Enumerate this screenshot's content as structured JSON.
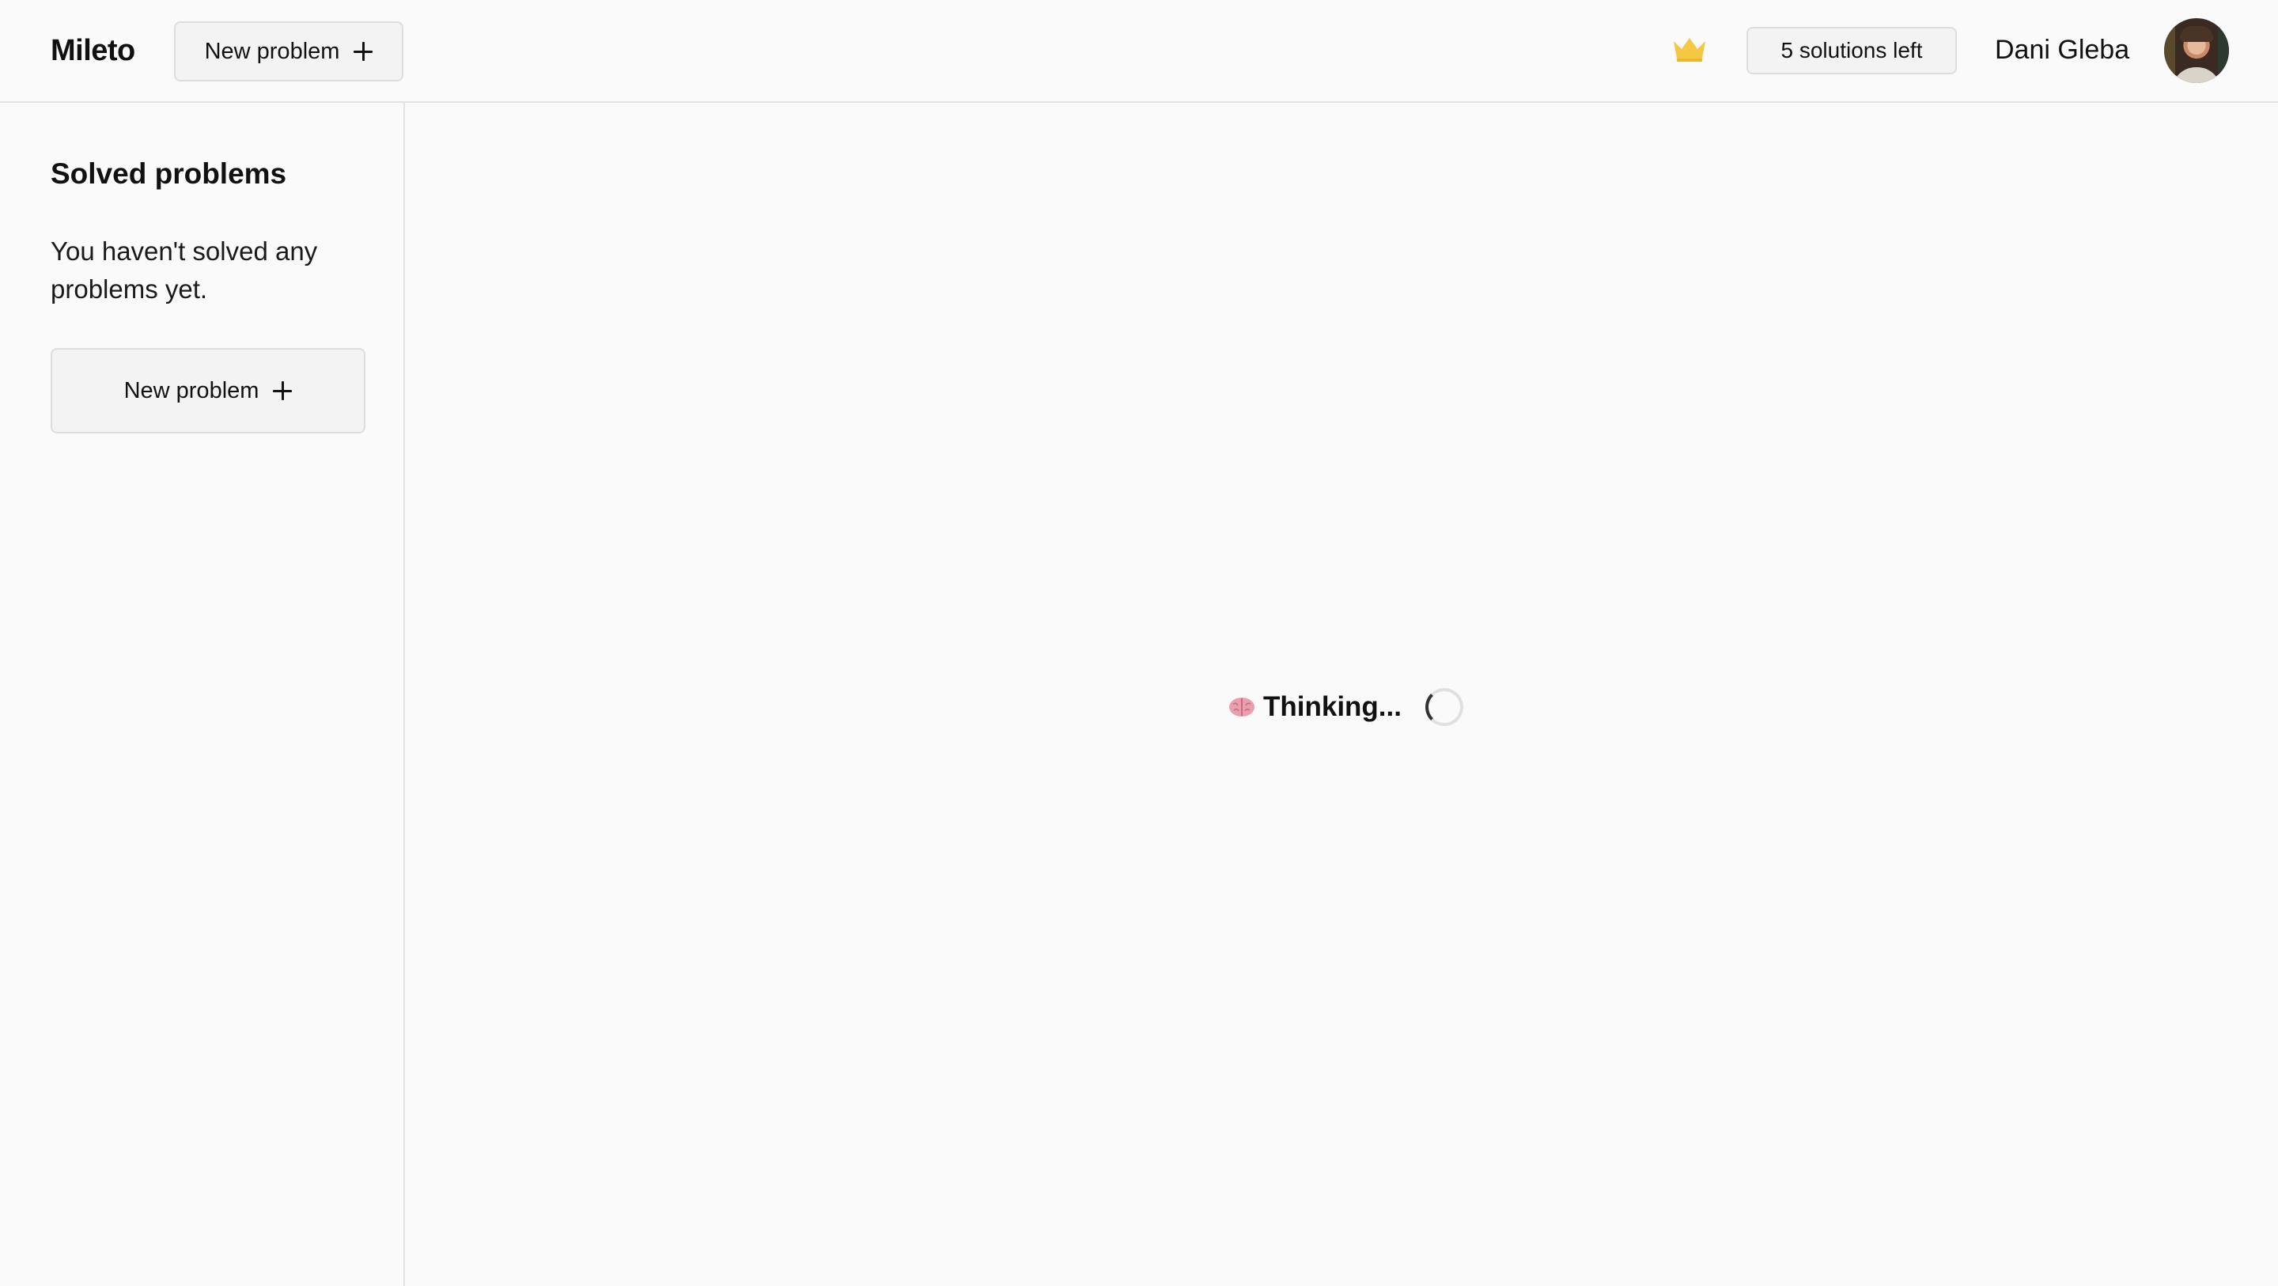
{
  "header": {
    "app_title": "Mileto",
    "new_problem_label": "New problem",
    "solutions_badge": "5 solutions left",
    "user_name": "Dani Gleba"
  },
  "sidebar": {
    "title": "Solved problems",
    "empty_message": "You haven't solved any problems yet.",
    "new_problem_label": "New problem"
  },
  "main": {
    "status_text": "Thinking..."
  },
  "icons": {
    "crown": "crown-icon",
    "plus": "plus-icon",
    "brain": "brain-icon",
    "spinner": "loading-spinner"
  },
  "colors": {
    "crown": "#f5c842",
    "background": "#fafafa",
    "border": "#e3e3e3"
  }
}
